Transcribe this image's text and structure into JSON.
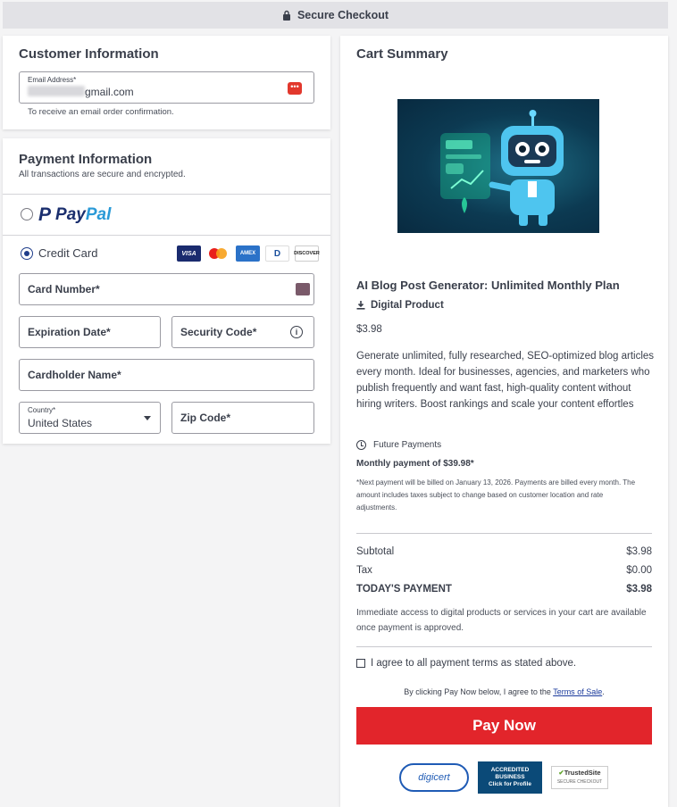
{
  "header": {
    "title": "Secure Checkout"
  },
  "customer": {
    "heading": "Customer Information",
    "email_label": "Email Address*",
    "email_value": "gmail.com",
    "hint": "To receive an email order confirmation."
  },
  "payment": {
    "heading": "Payment Information",
    "subtitle": "All transactions are secure and encrypted.",
    "paypal_part1": "Pay",
    "paypal_part2": "Pal",
    "credit_card_label": "Credit Card",
    "brands": [
      "VISA",
      "MC",
      "AMEX",
      "D",
      "DISCOVER"
    ],
    "card_number": "Card Number*",
    "expiration": "Expiration Date*",
    "security_code": "Security Code*",
    "cardholder": "Cardholder Name*",
    "country_label": "Country*",
    "country_value": "United States",
    "zip": "Zip Code*"
  },
  "cart": {
    "heading": "Cart Summary",
    "product_title": "AI Blog Post Generator: Unlimited Monthly Plan",
    "product_kind": "Digital Product",
    "price": "$3.98",
    "description": "Generate unlimited, fully researched, SEO-optimized blog articles every month. Ideal for businesses, agencies, and marketers who publish frequently and want fast, high-quality content without hiring writers. Boost rankings and scale your content effortles",
    "future_payments": "Future Payments",
    "monthly": "Monthly payment of $39.98*",
    "note": "*Next payment will be billed on January 13, 2026. Payments are billed every month. The amount includes taxes subject to change based on customer location and rate adjustments.",
    "subtotal_label": "Subtotal",
    "subtotal_value": "$3.98",
    "tax_label": "Tax",
    "tax_value": "$0.00",
    "today_label": "TODAY'S PAYMENT",
    "today_value": "$3.98",
    "access_note": "Immediate access to digital products or services in your cart are available once payment is approved.",
    "agree": "I agree to all payment terms as stated above.",
    "byclick_prefix": "By clicking Pay Now below, I agree to the ",
    "terms_link": "Terms of Sale",
    "byclick_suffix": ".",
    "pay_button": "Pay Now"
  },
  "badges": {
    "digicert": "digicert",
    "bbb_line1": "ACCREDITED",
    "bbb_line2": "BUSINESS",
    "bbb_line3": "Click for Profile",
    "trusted": "TrustedSite",
    "trusted_sub": "SECURE CHECKOUT"
  },
  "colors": {
    "accent": "#e2252b",
    "radio": "#1f3d8a",
    "paypal_dark": "#1b2f6e",
    "paypal_light": "#2a9ad7"
  }
}
